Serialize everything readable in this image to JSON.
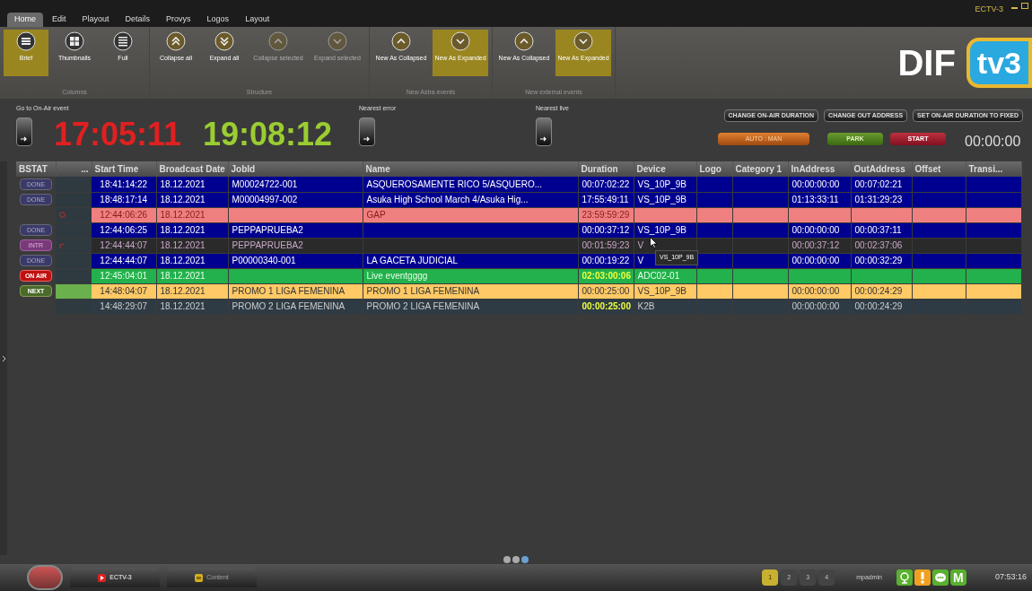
{
  "window": {
    "title": "ECTV-3"
  },
  "menu_tabs": [
    {
      "label": "Home",
      "selected": true
    },
    {
      "label": "Edit",
      "selected": false
    },
    {
      "label": "Playout",
      "selected": false
    },
    {
      "label": "Details",
      "selected": false
    },
    {
      "label": "Provys",
      "selected": false
    },
    {
      "label": "Logos",
      "selected": false
    },
    {
      "label": "Layout",
      "selected": false
    }
  ],
  "ribbon_groups": [
    {
      "title": "Columns",
      "buttons": [
        {
          "label": "Brief",
          "kind": "list",
          "selected": true,
          "disabled": false
        },
        {
          "label": "Thumbnails",
          "kind": "grid",
          "selected": false,
          "disabled": false
        },
        {
          "label": "Full",
          "kind": "lines",
          "selected": false,
          "disabled": false
        }
      ]
    },
    {
      "title": "Structure",
      "buttons": [
        {
          "label": "Collapse all",
          "kind": "up2",
          "selected": false,
          "disabled": false
        },
        {
          "label": "Expand all",
          "kind": "down2",
          "selected": false,
          "disabled": false
        },
        {
          "label": "Collapse selected",
          "kind": "up",
          "selected": false,
          "disabled": true
        },
        {
          "label": "Expand selected",
          "kind": "down",
          "selected": false,
          "disabled": true
        }
      ]
    },
    {
      "title": "New Astra events",
      "buttons": [
        {
          "label": "New As Collapsed",
          "kind": "up",
          "selected": false,
          "disabled": false
        },
        {
          "label": "New As Expanded",
          "kind": "down",
          "selected": true,
          "disabled": false
        }
      ]
    },
    {
      "title": "New external events",
      "buttons": [
        {
          "label": "New As Collapsed",
          "kind": "up",
          "selected": false,
          "disabled": false
        },
        {
          "label": "New As Expanded",
          "kind": "down",
          "selected": true,
          "disabled": false
        }
      ]
    }
  ],
  "logo": {
    "text": "DIF",
    "badge": "tv3"
  },
  "controls": {
    "goto_label": "Go to On-Air event",
    "clock_current": "17:05:11",
    "clock_remaining": "19:08:12",
    "nearest_error_label": "Nearest error",
    "nearest_live_label": "Nearest live",
    "action_buttons": [
      "CHANGE ON-AIR DURATION",
      "CHANGE OUT ADDRESS",
      "SET ON-AIR DURATION TO FIXED"
    ],
    "mode_button": "AUTO : MAN",
    "park_button": "PARK",
    "start_button": "START",
    "timer": "00:00:00"
  },
  "table": {
    "columns": [
      "BSTAT",
      "...",
      "Start Time",
      "Broadcast Date",
      "JobId",
      "Name",
      "Duration",
      "Device",
      "Logo",
      "Category 1",
      "InAddress",
      "OutAddress",
      "Offset",
      "Transi..."
    ],
    "rows": [
      {
        "kind": "done",
        "status": "DONE",
        "start": "18:41:14:22",
        "date": "18.12.2021",
        "jobid": "M00024722-001",
        "name": "ASQUEROSAMENTE RICO 5/ASQUERO...",
        "duration": "00:07:02:22",
        "device": "VS_10P_9B",
        "in": "00:00:00:00",
        "out": "00:07:02:21"
      },
      {
        "kind": "done",
        "status": "DONE",
        "start": "18:48:17:14",
        "date": "18.12.2021",
        "jobid": "M00004997-002",
        "name": "Asuka High School March 4/Asuka Hig...",
        "duration": "17:55:49:11",
        "device": "VS_10P_9B",
        "in": "01:13:33:11",
        "out": "01:31:29:23"
      },
      {
        "kind": "gap",
        "start": "12:44:06:26",
        "date": "18.12.2021",
        "name": "GAP",
        "duration": "23:59:59:29"
      },
      {
        "kind": "done",
        "status": "DONE",
        "start": "12:44:06:25",
        "date": "18.12.2021",
        "jobid": "PEPPAPRUEBA2",
        "duration": "00:00:37:12",
        "device": "VS_10P_9B",
        "in": "00:00:00:00",
        "out": "00:00:37:11"
      },
      {
        "kind": "intr",
        "status": "INTR",
        "start": "12:44:44:07",
        "date": "18.12.2021",
        "jobid": "PEPPAPRUEBA2",
        "duration": "00:01:59:23",
        "device": "V",
        "in": "00:00:37:12",
        "out": "00:02:37:06"
      },
      {
        "kind": "done",
        "status": "DONE",
        "start": "12:44:44:07",
        "date": "18.12.2021",
        "jobid": "P00000340-001",
        "name": "LA GACETA JUDICIAL",
        "duration": "00:00:19:22",
        "device": "V",
        "in": "00:00:00:00",
        "out": "00:00:32:29"
      },
      {
        "kind": "onair",
        "status": "ON AIR",
        "start": "12:45:04:01",
        "date": "18.12.2021",
        "name": "Live eventgggg",
        "duration": "02:03:00:06",
        "device": "ADC02-01"
      },
      {
        "kind": "next",
        "status": "NEXT",
        "start": "14:48:04:07",
        "date": "18.12.2021",
        "jobid": "PROMO 1 LIGA FEMENINA",
        "name": "PROMO 1 LIGA FEMENINA",
        "duration": "00:00:25:00",
        "device": "VS_10P_9B",
        "in": "00:00:00:00",
        "out": "00:00:24:29"
      },
      {
        "kind": "plain",
        "start": "14:48:29:07",
        "date": "18.12.2021",
        "jobid": "PROMO 2 LIGA FEMENINA",
        "name": "PROMO 2 LIGA FEMENINA",
        "duration": "00:00:25:00",
        "device": "K2B",
        "in": "00:00:00:00",
        "out": "00:00:24:29"
      }
    ],
    "tooltip": "VS_10P_9B"
  },
  "taskbar": {
    "tabs": [
      {
        "label": "ECTV-3",
        "kind": "play",
        "selected": true
      },
      {
        "label": "Content",
        "kind": "folder",
        "selected": false
      }
    ],
    "pages": [
      {
        "label": "1",
        "selected": true
      },
      {
        "label": "2",
        "selected": false
      },
      {
        "label": "3",
        "selected": false
      },
      {
        "label": "4",
        "selected": false
      }
    ],
    "user": "mpadmin",
    "status_icons": [
      {
        "kind": "globe"
      },
      {
        "kind": "alert"
      },
      {
        "kind": "chat"
      },
      {
        "kind": "letter",
        "label": "M"
      }
    ],
    "time": "07:53:16"
  }
}
